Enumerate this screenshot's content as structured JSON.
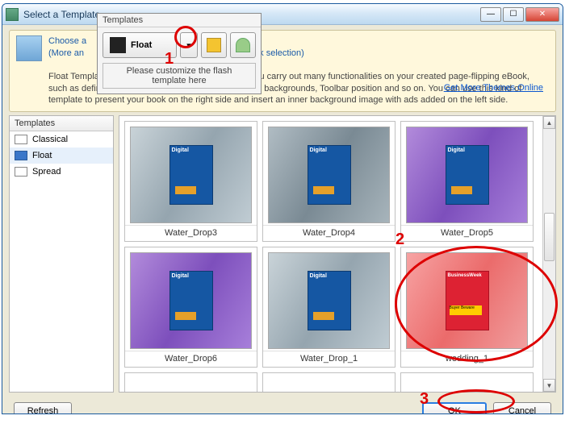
{
  "window": {
    "title": "Select a Template"
  },
  "popup": {
    "header": "Templates",
    "float_label": "Float",
    "hint": "Please customize the flash template here"
  },
  "intro": {
    "line1_a": "Choose a",
    "line1_b": "(More an",
    "line1_tail": "uick selection)",
    "body": "Float Template is the most flexible template to help you carry out many functionalities on your created page-flipping eBook, such as define Book Title, Book Logo, Outer and Inner backgrounds, Toolbar position and so on. You can use this kind of template to present your book on the right side and insert an inner background image with ads added on the left side.",
    "link": "Get More Themes Online"
  },
  "sidebar": {
    "header": "Templates",
    "items": [
      {
        "label": "Classical"
      },
      {
        "label": "Float"
      },
      {
        "label": "Spread"
      }
    ]
  },
  "grid": {
    "cells": [
      {
        "caption": "Water_Drop3"
      },
      {
        "caption": "Water_Drop4"
      },
      {
        "caption": "Water_Drop5"
      },
      {
        "caption": "Water_Drop6"
      },
      {
        "caption": "Water_Drop_1"
      },
      {
        "caption": "wedding_1"
      }
    ]
  },
  "footer": {
    "refresh": "Refresh",
    "ok": "OK",
    "cancel": "Cancel"
  },
  "annotations": {
    "n1": "1",
    "n2": "2",
    "n3": "3"
  }
}
